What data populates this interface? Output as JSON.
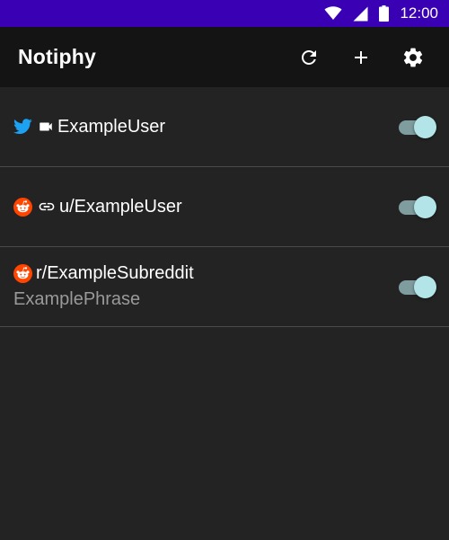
{
  "status_bar": {
    "time": "12:00",
    "background": "#3a00b3",
    "icons": [
      "wifi-icon",
      "cell-signal-icon",
      "battery-icon"
    ]
  },
  "app_bar": {
    "title": "Notiphy",
    "background": "#141414",
    "actions": [
      "refresh-icon",
      "add-icon",
      "settings-icon"
    ]
  },
  "accent": {
    "toggle_thumb": "#b3e5e8",
    "toggle_track": "#7f9c9f",
    "twitter_blue": "#1da1f2",
    "reddit_orange": "#ff4500"
  },
  "items": [
    {
      "source_icon": "twitter-icon",
      "type_icon": "video-icon",
      "title": "ExampleUser",
      "subtitle": "",
      "enabled": true
    },
    {
      "source_icon": "reddit-icon",
      "type_icon": "link-icon",
      "title": "u/ExampleUser",
      "subtitle": "",
      "enabled": true
    },
    {
      "source_icon": "reddit-icon",
      "type_icon": "",
      "title": "r/ExampleSubreddit",
      "subtitle": "ExamplePhrase",
      "enabled": true
    }
  ]
}
